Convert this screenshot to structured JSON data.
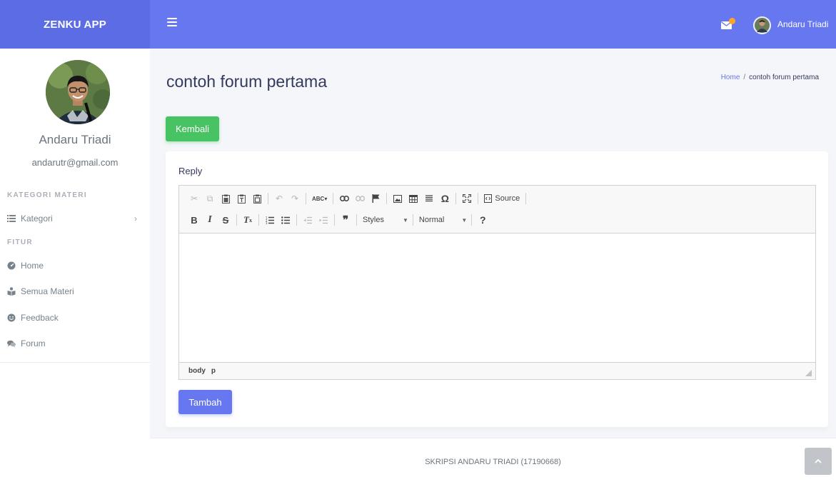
{
  "app": {
    "brand": "ZENKU APP"
  },
  "topbar": {
    "menu_icon": "hamburger-icon",
    "mail_icon": "envelope-icon",
    "user_name": "Andaru Triadi"
  },
  "sidebar": {
    "profile_name": "Andaru Triadi",
    "profile_email": "andarutr@gmail.com",
    "section_kategori": "KATEGORI MATERI",
    "kategori_label": "Kategori",
    "section_fitur": "FITUR",
    "items": [
      {
        "label": "Home",
        "icon": "dashboard-icon"
      },
      {
        "label": "Semua Materi",
        "icon": "reader-icon"
      },
      {
        "label": "Feedback",
        "icon": "smile-icon"
      },
      {
        "label": "Forum",
        "icon": "comments-icon"
      }
    ]
  },
  "main": {
    "page_title": "contoh forum pertama",
    "breadcrumb": {
      "home": "Home",
      "sep": "/",
      "current": "contoh forum pertama"
    },
    "back_button": "Kembali",
    "reply_label": "Reply",
    "submit_button": "Tambah"
  },
  "editor": {
    "source_label": "Source",
    "styles_label": "Styles",
    "format_label": "Normal",
    "help_label": "?",
    "status_path": [
      "body",
      "p"
    ]
  },
  "footer": {
    "text": "SKRIPSI ANDARU TRIADI (17190668)"
  },
  "colors": {
    "primary": "#6777ef",
    "success": "#47c363",
    "warning": "#ffa426"
  }
}
